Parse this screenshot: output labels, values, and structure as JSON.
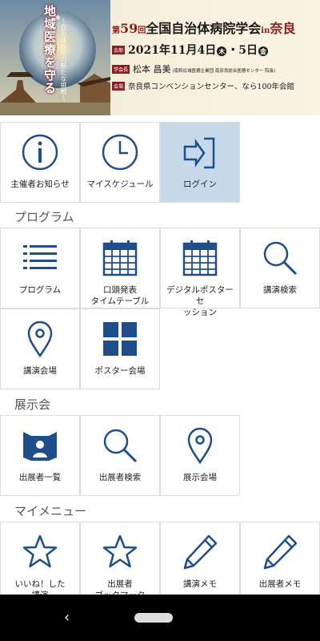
{
  "banner": {
    "vertical_title": "地域医療を守る",
    "vertical_subtitle": "〜自治体病院の新たな挑戦〜",
    "edition_prefix": "第",
    "edition_num": "59",
    "edition_suffix": "回",
    "title": "全国自治体病院学会",
    "title_in": "in",
    "title_place": "奈良",
    "date_tag": "会期",
    "date_text": "2021年11月4日",
    "date_day1": "木",
    "date_mid": "・5日",
    "date_day2": "金",
    "chair_tag": "学会長",
    "chair_name": "松本 昌美",
    "chair_affiliation": "(南和広域医療企業団 南奈良総合医療センター 院長)",
    "venue_tag": "会場",
    "venue_text": "奈良県コンベンションセンター、なら100年会館"
  },
  "sections": {
    "program": "プログラム",
    "exhibition": "展示会",
    "mymenu": "マイメニュー"
  },
  "tiles": {
    "organizer_news": "主催者お知らせ",
    "my_schedule": "マイスケジュール",
    "login": "ログイン",
    "program": "プログラム",
    "oral_timetable": "口頭発表\nタイムテーブル",
    "digital_poster": "デジタルポスターセ\nッション",
    "lecture_search": "講演検索",
    "lecture_venue": "講演会場",
    "poster_venue": "ポスター会場",
    "exhibitor_list": "出展者一覧",
    "exhibitor_search": "出展者検索",
    "exhibition_venue": "展示会場",
    "liked_lectures": "いいね！した\n講演",
    "exhibitor_bookmark": "出展者\nブックマーク",
    "lecture_memo": "講演メモ",
    "exhibitor_memo": "出展者メモ"
  },
  "colors": {
    "icon_blue": "#1f4e8c",
    "active_tile": "#c6d9e8",
    "banner_red": "#8a1d1d"
  },
  "nav": {
    "back_icon": "‹"
  }
}
